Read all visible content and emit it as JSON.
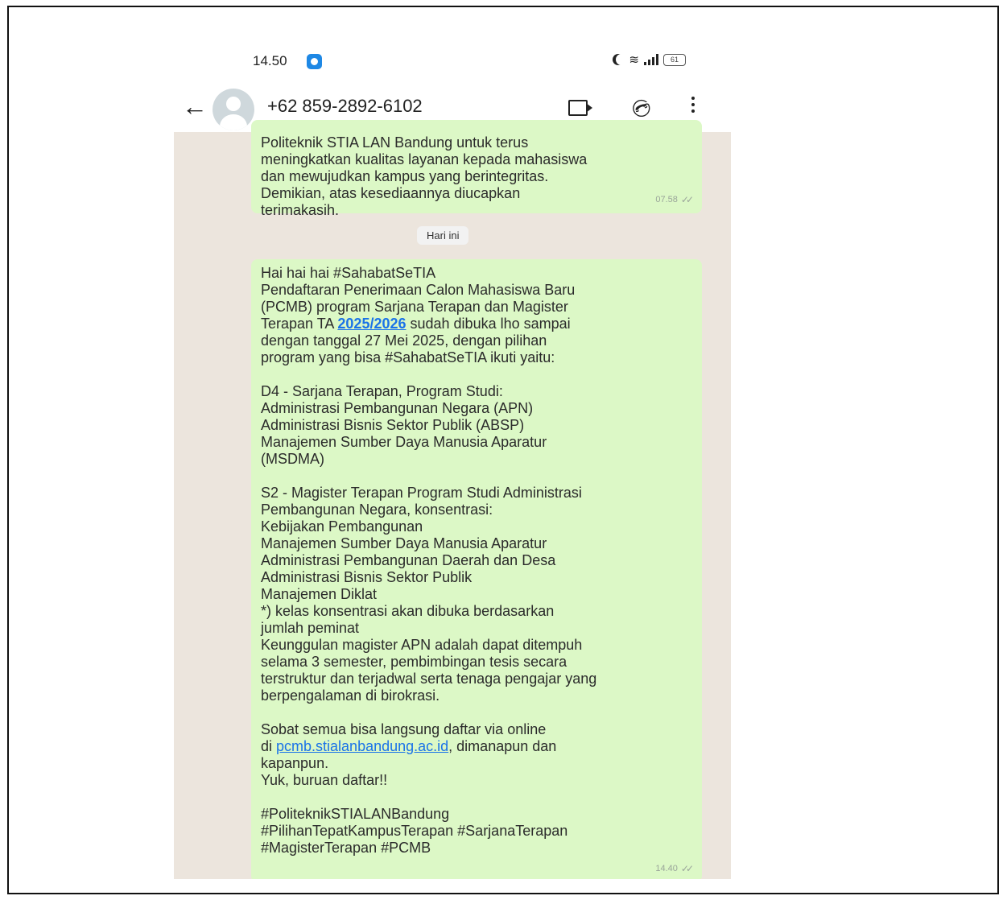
{
  "status_bar": {
    "time": "14.50",
    "battery": "61"
  },
  "header": {
    "contact": "+62 859-2892-6102"
  },
  "messages": {
    "first": {
      "text": "Politeknik STIA LAN Bandung untuk terus\nmeningkatkan kualitas layanan kepada mahasiswa\ndan mewujudkan kampus yang berintegritas.\nDemikian, atas kesediaannya diucapkan\nterimakasih.",
      "time": "07.58"
    },
    "date_separator": "Hari ini",
    "second": {
      "part1": "Hai hai hai #SahabatSeTIA\nPendaftaran Penerimaan Calon Mahasiswa Baru\n(PCMB) program Sarjana Terapan dan Magister\nTerapan TA ",
      "highlight": "2025/2026",
      "part2": " sudah dibuka lho sampai\ndengan tanggal 27 Mei 2025, dengan pilihan\nprogram yang bisa #SahabatSeTIA ikuti yaitu:\n\nD4 - Sarjana Terapan, Program Studi:\nAdministrasi Pembangunan Negara (APN)\nAdministrasi Bisnis Sektor Publik (ABSP)\nManajemen Sumber Daya Manusia Aparatur\n(MSDMA)\n\nS2 - Magister Terapan Program Studi Administrasi\nPembangunan Negara, konsentrasi:\nKebijakan Pembangunan\nManajemen Sumber Daya Manusia Aparatur\nAdministrasi Pembangunan Daerah dan Desa\nAdministrasi Bisnis Sektor Publik\nManajemen Diklat\n*) kelas konsentrasi akan dibuka berdasarkan\njumlah peminat\nKeunggulan magister APN adalah dapat ditempuh\nselama 3 semester, pembimbingan tesis secara\nterstruktur dan terjadwal serta tenaga pengajar yang\nberpengalaman di birokrasi.\n\nSobat semua bisa langsung daftar via online\ndi ",
      "link": "pcmb.stialanbandung.ac.id",
      "part3": ", dimanapun dan\nkapanpun.\nYuk, buruan daftar!!\n\n#PoliteknikSTIALANBandung\n#PilihanTepatKampusTerapan #SarjanaTerapan\n#MagisterTerapan #PCMB",
      "time": "14.40"
    }
  },
  "colors": {
    "bubble": "#dcf8c6",
    "chat_background": "#ece5dd",
    "link": "#1a73e8"
  }
}
